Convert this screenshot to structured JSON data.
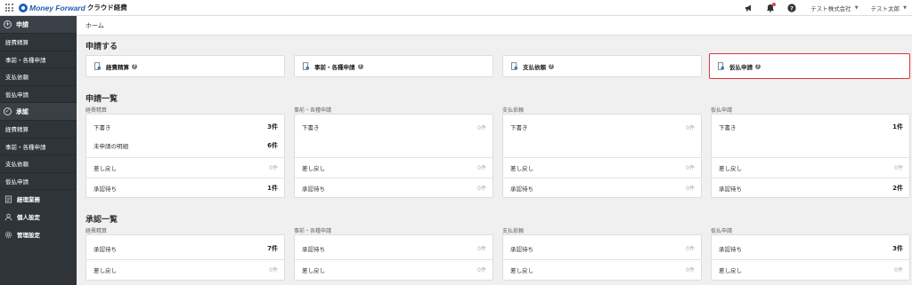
{
  "header": {
    "brand": "Money Forward",
    "product": "クラウド経費",
    "company": "テスト株式会社",
    "user": "テスト太郎"
  },
  "sidebar": {
    "apply_section": "申請",
    "apply_items": [
      "経費精算",
      "事前・各種申請",
      "支払依頼",
      "仮払申請"
    ],
    "approve_section": "承認",
    "approve_items": [
      "経費精算",
      "事前・各種申請",
      "支払依頼",
      "仮払申請"
    ],
    "extra_items": [
      "経理業務",
      "個人設定",
      "管理設定"
    ]
  },
  "breadcrumb": "ホーム",
  "apply": {
    "title": "申請する",
    "cards": [
      "経費精算",
      "事前・各種申請",
      "支払依頼",
      "仮払申請"
    ]
  },
  "application_list": {
    "title": "申請一覧",
    "columns": [
      {
        "label": "経費精算",
        "rows": [
          {
            "label": "下書き",
            "count": "3件"
          },
          {
            "label": "未申請の明細",
            "count": "6件"
          },
          {
            "label": "差し戻し",
            "count": "0件"
          },
          {
            "label": "承認待ち",
            "count": "1件"
          }
        ]
      },
      {
        "label": "事前・各種申請",
        "rows": [
          {
            "label": "下書き",
            "count": "0件"
          },
          {
            "label": "差し戻し",
            "count": "0件"
          },
          {
            "label": "承認待ち",
            "count": "0件"
          }
        ]
      },
      {
        "label": "支払依頼",
        "rows": [
          {
            "label": "下書き",
            "count": "0件"
          },
          {
            "label": "差し戻し",
            "count": "0件"
          },
          {
            "label": "承認待ち",
            "count": "0件"
          }
        ]
      },
      {
        "label": "仮払申請",
        "rows": [
          {
            "label": "下書き",
            "count": "1件"
          },
          {
            "label": "差し戻し",
            "count": "0件"
          },
          {
            "label": "承認待ち",
            "count": "2件"
          }
        ]
      }
    ]
  },
  "approval_list": {
    "title": "承認一覧",
    "columns": [
      {
        "label": "経費精算",
        "rows": [
          {
            "label": "承認待ち",
            "count": "7件"
          },
          {
            "label": "差し戻し",
            "count": "0件"
          }
        ]
      },
      {
        "label": "事前・各種申請",
        "rows": [
          {
            "label": "承認待ち",
            "count": "0件"
          },
          {
            "label": "差し戻し",
            "count": "0件"
          }
        ]
      },
      {
        "label": "支払依頼",
        "rows": [
          {
            "label": "承認待ち",
            "count": "0件"
          },
          {
            "label": "差し戻し",
            "count": "0件"
          }
        ]
      },
      {
        "label": "仮払申請",
        "rows": [
          {
            "label": "承認待ち",
            "count": "3件"
          },
          {
            "label": "差し戻し",
            "count": "0件"
          }
        ]
      }
    ]
  },
  "icons": {
    "apps": "grid-icon",
    "announce": "megaphone-icon",
    "notifications": "bell-icon",
    "help": "question-icon",
    "apply_card": "document-icon",
    "highlight_color": "#e0343a",
    "brand_color": "#1d5fb8"
  }
}
